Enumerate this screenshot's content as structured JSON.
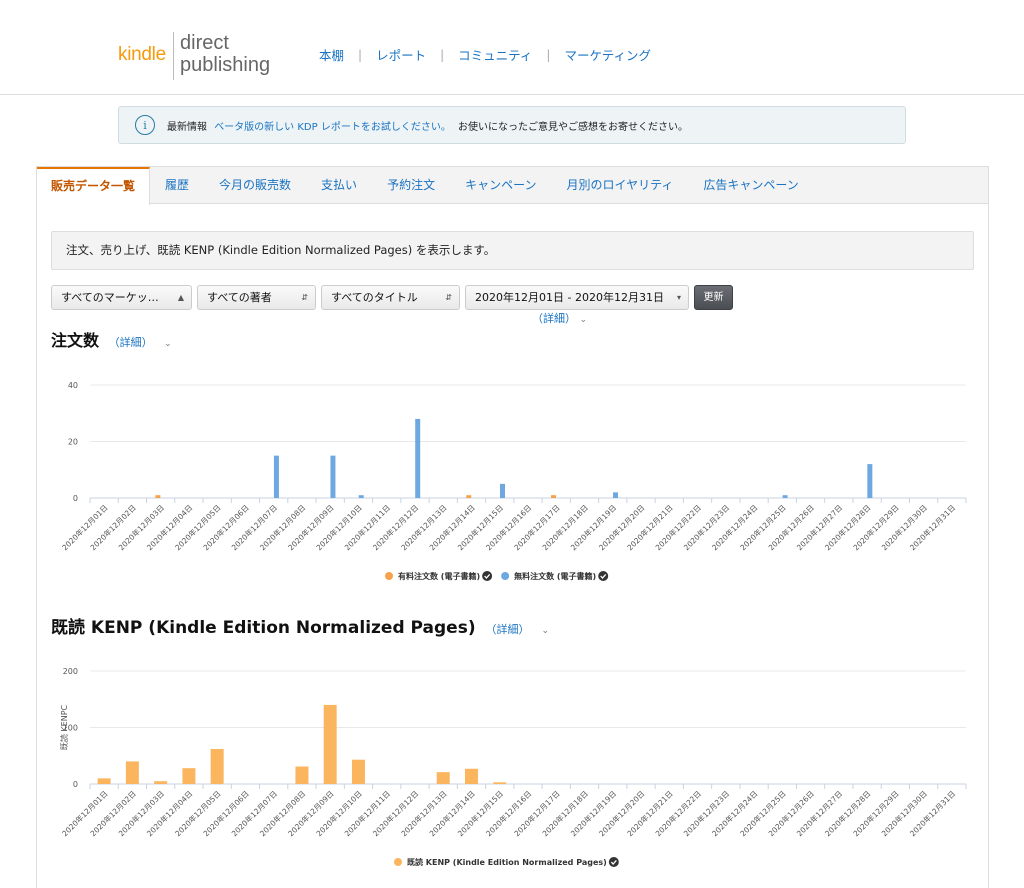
{
  "header": {
    "logo_kindle": "kindle",
    "logo_direct": "direct",
    "logo_publishing": "publishing",
    "nav": [
      "本棚",
      "レポート",
      "コミュニティ",
      "マーケティング"
    ]
  },
  "banner": {
    "prefix": "最新情報",
    "link": "ベータ版の新しい KDP レポートをお試しください。",
    "suffix": "お使いになったご意見やご感想をお寄せください。"
  },
  "tabs": [
    "販売データ一覧",
    "履歴",
    "今月の販売数",
    "支払い",
    "予約注文",
    "キャンペーン",
    "月別のロイヤリティ",
    "広告キャンペーン"
  ],
  "description": "注文、売り上げ、既読 KENP (Kindle Edition Normalized Pages) を表示します。",
  "filters": {
    "marketplace": "すべてのマーケッ…",
    "author": "すべての著者",
    "title": "すべてのタイトル",
    "date_range": "2020年12月01日 - 2020年12月31日",
    "update": "更新",
    "detail": "（詳細）"
  },
  "orders_section": {
    "title": "注文数",
    "detail": "（詳細）"
  },
  "kenp_section": {
    "title": "既読 KENP (Kindle Edition Normalized Pages)",
    "detail": "（詳細）"
  },
  "colors": {
    "paid": "#f7a24a",
    "free": "#6ea8e0",
    "kenp": "#fbb55f",
    "accent": "#e77600",
    "link": "#1a73c2"
  },
  "chart_data": [
    {
      "type": "bar",
      "title": "",
      "ylim": [
        0,
        40
      ],
      "yticks": [
        0,
        20,
        40
      ],
      "categories": [
        "2020年12月01日",
        "2020年12月02日",
        "2020年12月03日",
        "2020年12月04日",
        "2020年12月05日",
        "2020年12月06日",
        "2020年12月07日",
        "2020年12月08日",
        "2020年12月09日",
        "2020年12月10日",
        "2020年12月11日",
        "2020年12月12日",
        "2020年12月13日",
        "2020年12月14日",
        "2020年12月15日",
        "2020年12月16日",
        "2020年12月17日",
        "2020年12月18日",
        "2020年12月19日",
        "2020年12月20日",
        "2020年12月21日",
        "2020年12月22日",
        "2020年12月23日",
        "2020年12月24日",
        "2020年12月25日",
        "2020年12月26日",
        "2020年12月27日",
        "2020年12月28日",
        "2020年12月29日",
        "2020年12月30日",
        "2020年12月31日"
      ],
      "series": [
        {
          "name": "有料注文数 (電子書籍)",
          "color": "#f7a24a",
          "values": [
            0,
            0,
            1,
            0,
            0,
            0,
            0,
            0,
            0,
            0,
            0,
            0,
            0,
            1,
            0,
            0,
            1,
            0,
            0,
            0,
            0,
            0,
            0,
            0,
            0,
            0,
            0,
            0,
            0,
            0,
            0
          ]
        },
        {
          "name": "無料注文数 (電子書籍)",
          "color": "#6ea8e0",
          "values": [
            0,
            0,
            0,
            0,
            0,
            0,
            15,
            0,
            15,
            1,
            0,
            28,
            0,
            0,
            5,
            0,
            0,
            0,
            2,
            0,
            0,
            0,
            0,
            0,
            1,
            0,
            0,
            12,
            0,
            0,
            0
          ]
        }
      ],
      "legend": "bottom"
    },
    {
      "type": "bar",
      "title": "",
      "ylabel": "既読 KENPC",
      "ylim": [
        0,
        200
      ],
      "yticks": [
        0,
        100,
        200
      ],
      "categories": [
        "2020年12月01日",
        "2020年12月02日",
        "2020年12月03日",
        "2020年12月04日",
        "2020年12月05日",
        "2020年12月06日",
        "2020年12月07日",
        "2020年12月08日",
        "2020年12月09日",
        "2020年12月10日",
        "2020年12月11日",
        "2020年12月12日",
        "2020年12月13日",
        "2020年12月14日",
        "2020年12月15日",
        "2020年12月16日",
        "2020年12月17日",
        "2020年12月18日",
        "2020年12月19日",
        "2020年12月20日",
        "2020年12月21日",
        "2020年12月22日",
        "2020年12月23日",
        "2020年12月24日",
        "2020年12月25日",
        "2020年12月26日",
        "2020年12月27日",
        "2020年12月28日",
        "2020年12月29日",
        "2020年12月30日",
        "2020年12月31日"
      ],
      "series": [
        {
          "name": "既読 KENP (Kindle Edition Normalized Pages)",
          "color": "#fbb55f",
          "values": [
            10,
            40,
            5,
            28,
            62,
            0,
            0,
            31,
            140,
            43,
            0,
            0,
            21,
            27,
            3,
            0,
            0,
            0,
            0,
            0,
            0,
            0,
            0,
            0,
            0,
            0,
            0,
            0,
            0,
            0,
            0
          ]
        }
      ],
      "legend": "bottom"
    }
  ]
}
